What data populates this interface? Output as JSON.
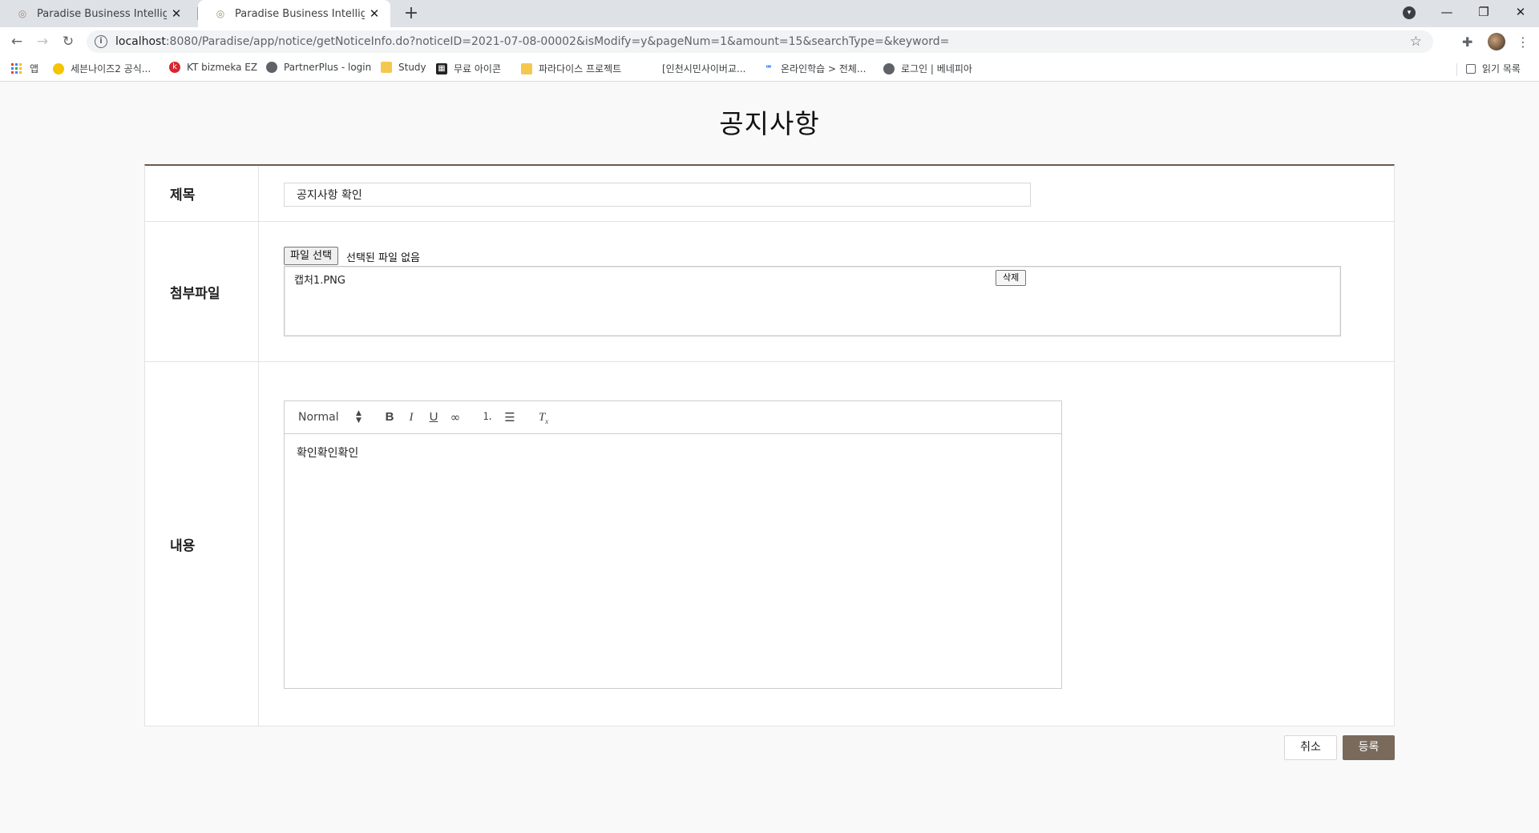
{
  "browser": {
    "tabs": [
      {
        "title": "Paradise Business Intelligence D",
        "active": false
      },
      {
        "title": "Paradise Business Intelligence -",
        "active": true
      }
    ],
    "url_host": "localhost",
    "url_path": ":8080/Paradise/app/notice/getNoticeInfo.do?noticeID=2021-07-08-00002&isModify=y&pageNum=1&amount=15&searchType=&keyword=",
    "bookmarks": [
      {
        "label": "앱",
        "icon": "apps-grid-icon"
      },
      {
        "label": "세븐나이즈2 공식...",
        "icon": "game-icon"
      },
      {
        "label": "KT bizmeka EZ",
        "icon": "kt-icon"
      },
      {
        "label": "PartnerPlus - login",
        "icon": "globe-icon"
      },
      {
        "label": "Study",
        "icon": "folder-icon"
      },
      {
        "label": "무료 아이콘",
        "icon": "icon-site-icon"
      },
      {
        "label": "파라다이스 프로젝트",
        "icon": "folder-icon"
      },
      {
        "label": "[인천시민사이버교...",
        "icon": "blank-icon"
      },
      {
        "label": "온라인학습 > 전체...",
        "icon": "learning-icon"
      },
      {
        "label": "로그인 | 베네피아",
        "icon": "globe-icon"
      }
    ],
    "reading_list": "읽기 목록",
    "colors": {
      "tabstrip": "#dee1e6",
      "toolbar": "#ffffff"
    }
  },
  "page": {
    "title": "공지사항",
    "fields": {
      "title_label": "제목",
      "title_value": "공지사항 확인",
      "attach_label": "첨부파일",
      "file_button": "파일 선택",
      "file_none": "선택된 파일 없음",
      "attached_file": "캡처1.PNG",
      "delete_button": "삭제",
      "content_label": "내용",
      "content_value": "확인확인확인"
    },
    "editor": {
      "format_select": "Normal",
      "tools": [
        "bold-icon",
        "italic-icon",
        "underline-icon",
        "link-icon",
        "ordered-list-icon",
        "bullet-list-icon",
        "clear-format-icon"
      ]
    },
    "buttons": {
      "cancel": "취소",
      "submit": "등록"
    },
    "colors": {
      "accent": "#7a6a5c",
      "table_top_border": "#6b5a4d",
      "background": "#f9f9f9"
    }
  }
}
